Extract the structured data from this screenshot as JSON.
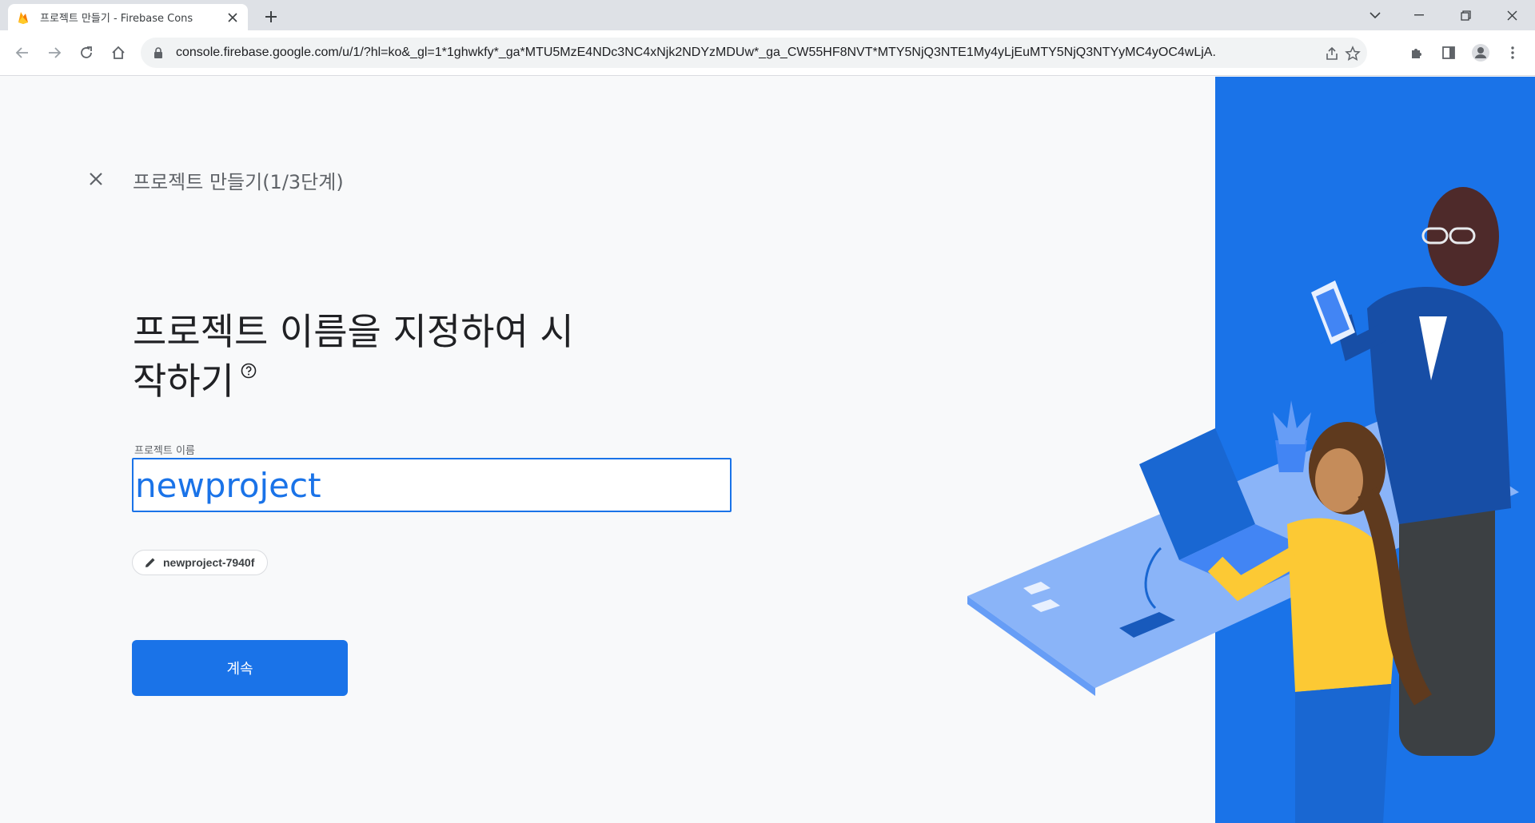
{
  "browser": {
    "tab_title": "프로젝트 만들기 - Firebase Cons",
    "url": "console.firebase.google.com/u/1/?hl=ko&_gl=1*1ghwkfy*_ga*MTU5MzE4NDc3NC4xNjk2NDYzMDUw*_ga_CW55HF8NVT*MTY5NjQ3NTE1My4yLjEuMTY5NjQ3NTYyMC4yOC4wLjA."
  },
  "page": {
    "step_title": "프로젝트 만들기(1/3단계)",
    "headline_line1": "프로젝트 이름을 지정하여 시",
    "headline_line2": "작하기",
    "field_label": "프로젝트 이름",
    "project_name_value": "newproject",
    "project_id": "newproject-7940f",
    "continue_label": "계속"
  },
  "colors": {
    "accent": "#1a73e8",
    "panel": "#1a73e8",
    "yellow": "#fcc934"
  },
  "icons": [
    "firebase-icon",
    "close-icon",
    "new-tab-icon",
    "minimize-icon",
    "restore-icon",
    "back-icon",
    "forward-icon",
    "reload-icon",
    "home-icon",
    "lock-icon",
    "share-icon",
    "star-icon",
    "extensions-icon",
    "side-panel-icon",
    "profile-icon",
    "menu-icon",
    "help-icon",
    "pencil-icon"
  ]
}
